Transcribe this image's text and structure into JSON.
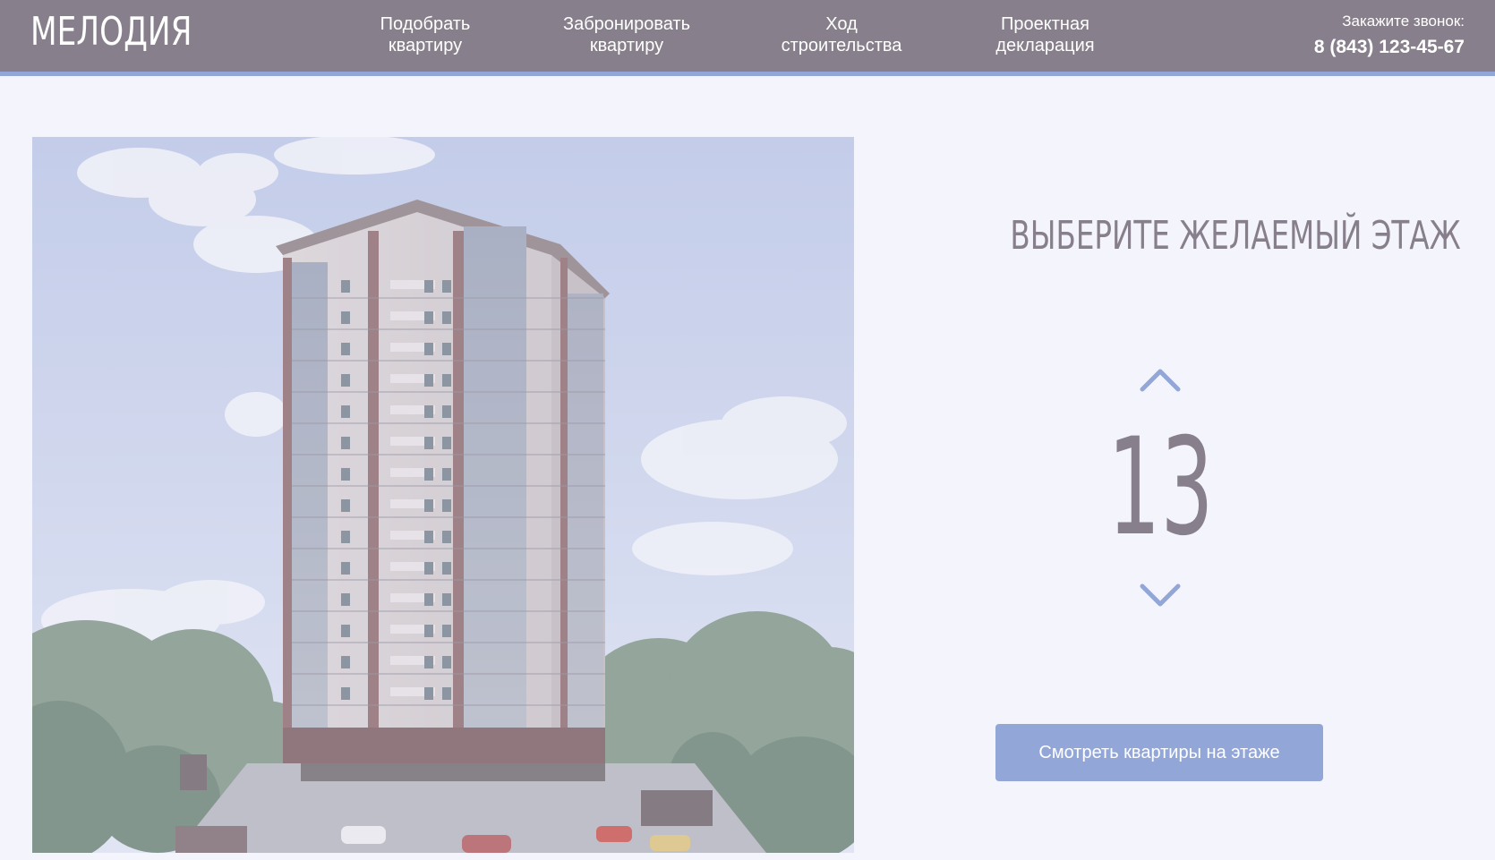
{
  "header": {
    "logo": "МЕЛОДИЯ",
    "nav": [
      {
        "line1": "Подобрать",
        "line2": "квартиру"
      },
      {
        "line1": "Забронировать",
        "line2": "квартиру"
      },
      {
        "line1": "Ход",
        "line2": "строительства"
      },
      {
        "line1": "Проектная",
        "line2": "декларация"
      }
    ],
    "call_label": "Закажите звонок:",
    "phone": "8 (843) 123-45-67"
  },
  "floor_selector": {
    "title": "ВЫБЕРИТЕ ЖЕЛАЕМЫЙ ЭТАЖ",
    "floor": "13",
    "up_icon": "chevron-up-icon",
    "down_icon": "chevron-down-icon",
    "button_label": "Смотреть квартиры на этаже"
  },
  "colors": {
    "header_bg": "#877f8b",
    "accent": "#93a6d8",
    "page_bg": "#f4f5fc",
    "text_muted": "#877f8b"
  }
}
